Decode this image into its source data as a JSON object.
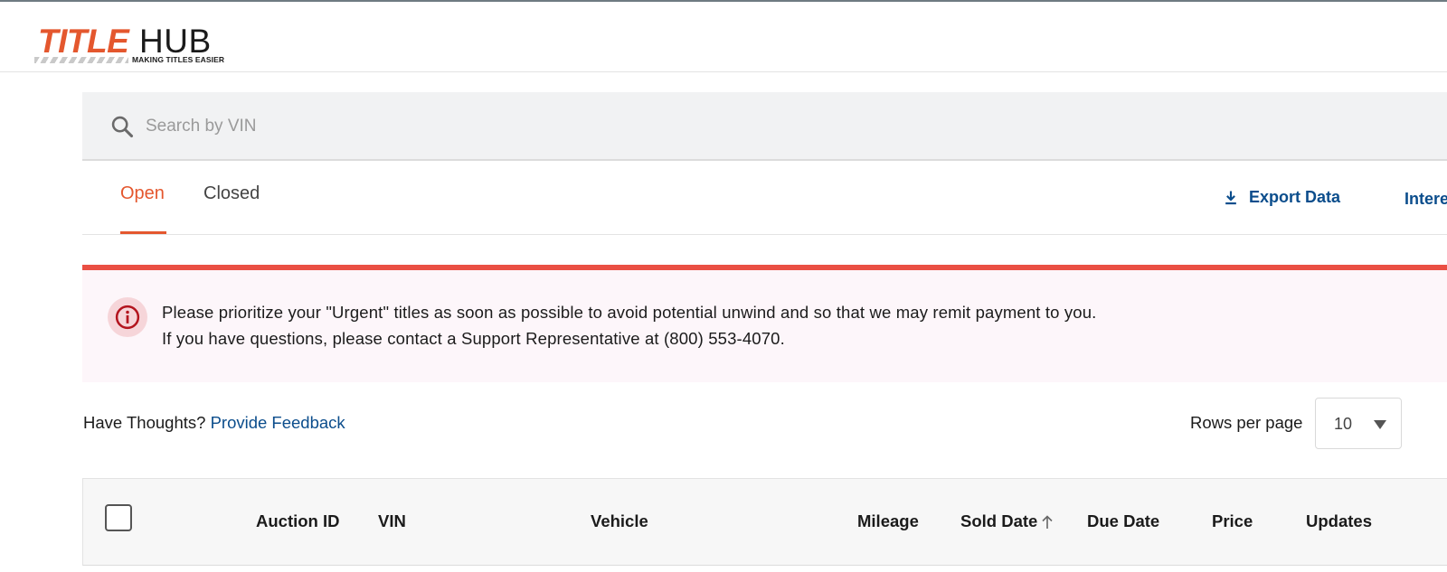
{
  "header": {
    "logo_title": "TITLE",
    "logo_hub": "HUB",
    "logo_tagline": "MAKING TITLES EASIER"
  },
  "search": {
    "placeholder": "Search by VIN",
    "value": ""
  },
  "tabs": [
    {
      "label": "Open",
      "active": true
    },
    {
      "label": "Closed",
      "active": false
    }
  ],
  "actions": {
    "export_label": "Export Data",
    "cut_off_label": "Intere"
  },
  "alert": {
    "line1": "Please prioritize your \"Urgent\" titles as soon as possible to avoid potential unwind and so that we may remit payment to you.",
    "line2": "If you have questions, please contact a Support Representative at (800) 553-4070."
  },
  "feedback": {
    "prompt": "Have Thoughts?",
    "link_label": "Provide Feedback"
  },
  "pagination": {
    "rows_label": "Rows per page",
    "rows_value": "10"
  },
  "table": {
    "columns": [
      "Auction ID",
      "VIN",
      "Vehicle",
      "Mileage",
      "Sold Date",
      "Due Date",
      "Price",
      "Updates"
    ],
    "sorted_column": "Sold Date",
    "sort_direction": "ascending"
  },
  "colors": {
    "accent_orange": "#e4572e",
    "link_blue": "#0b4d8c",
    "alert_red": "#ea4f43",
    "alert_bg": "#fdf6fa"
  }
}
